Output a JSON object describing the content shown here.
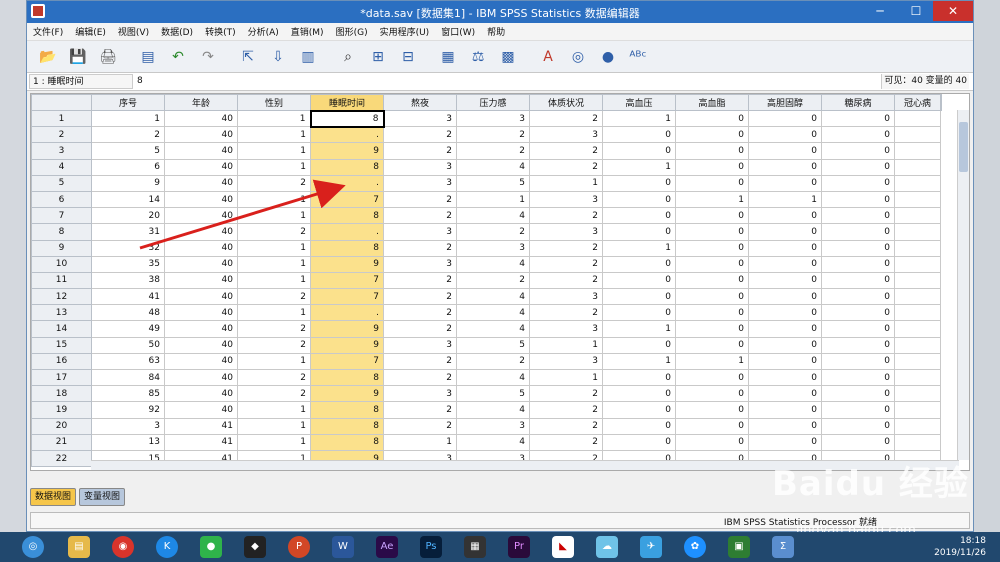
{
  "window": {
    "title": "*data.sav [数据集1] - IBM SPSS Statistics 数据编辑器",
    "min": "─",
    "max": "☐",
    "close": "✕"
  },
  "menu": [
    "文件(F)",
    "编辑(E)",
    "视图(V)",
    "数据(D)",
    "转换(T)",
    "分析(A)",
    "直销(M)",
    "图形(G)",
    "实用程序(U)",
    "窗口(W)",
    "帮助"
  ],
  "toolbar": [
    "open-icon",
    "save-icon",
    "print-icon",
    "recall-dialog-icon",
    "undo-icon",
    "redo-icon",
    "goto-case-icon",
    "goto-variable-icon",
    "variables-icon",
    "find-icon",
    "insert-cases-icon",
    "insert-variable-icon",
    "split-file-icon",
    "weight-cases-icon",
    "select-cases-icon",
    "value-labels-icon",
    "use-sets-icon",
    "show-all-icon",
    "spell-icon"
  ],
  "editline": {
    "cell_ref": "1 : 睡眠时间",
    "cell_value": "8",
    "visible": "可见：40 变量的 40"
  },
  "columns": [
    "序号",
    "年龄",
    "性别",
    "睡眠时间",
    "熬夜",
    "压力感",
    "体质状况",
    "高血压",
    "高血脂",
    "高胆固醇",
    "糖尿病",
    "冠心病"
  ],
  "rows": [
    [
      "1",
      "1",
      "40",
      "1",
      "8",
      "3",
      "3",
      "2",
      "1",
      "0",
      "0",
      "0",
      ""
    ],
    [
      "2",
      "2",
      "40",
      "1",
      ".",
      "2",
      "2",
      "3",
      "0",
      "0",
      "0",
      "0",
      ""
    ],
    [
      "3",
      "5",
      "40",
      "1",
      "9",
      "2",
      "2",
      "2",
      "0",
      "0",
      "0",
      "0",
      ""
    ],
    [
      "4",
      "6",
      "40",
      "1",
      "8",
      "3",
      "4",
      "2",
      "1",
      "0",
      "0",
      "0",
      ""
    ],
    [
      "5",
      "9",
      "40",
      "2",
      ".",
      "3",
      "5",
      "1",
      "0",
      "0",
      "0",
      "0",
      ""
    ],
    [
      "6",
      "14",
      "40",
      "1",
      "7",
      "2",
      "1",
      "3",
      "0",
      "1",
      "1",
      "0",
      ""
    ],
    [
      "7",
      "20",
      "40",
      "1",
      "8",
      "2",
      "4",
      "2",
      "0",
      "0",
      "0",
      "0",
      ""
    ],
    [
      "8",
      "31",
      "40",
      "2",
      ".",
      "3",
      "2",
      "3",
      "0",
      "0",
      "0",
      "0",
      ""
    ],
    [
      "9",
      "32",
      "40",
      "1",
      "8",
      "2",
      "3",
      "2",
      "1",
      "0",
      "0",
      "0",
      ""
    ],
    [
      "10",
      "35",
      "40",
      "1",
      "9",
      "3",
      "4",
      "2",
      "0",
      "0",
      "0",
      "0",
      ""
    ],
    [
      "11",
      "38",
      "40",
      "1",
      "7",
      "2",
      "2",
      "2",
      "0",
      "0",
      "0",
      "0",
      ""
    ],
    [
      "12",
      "41",
      "40",
      "2",
      "7",
      "2",
      "4",
      "3",
      "0",
      "0",
      "0",
      "0",
      ""
    ],
    [
      "13",
      "48",
      "40",
      "1",
      ".",
      "2",
      "4",
      "2",
      "0",
      "0",
      "0",
      "0",
      ""
    ],
    [
      "14",
      "49",
      "40",
      "2",
      "9",
      "2",
      "4",
      "3",
      "1",
      "0",
      "0",
      "0",
      ""
    ],
    [
      "15",
      "50",
      "40",
      "2",
      "9",
      "3",
      "5",
      "1",
      "0",
      "0",
      "0",
      "0",
      ""
    ],
    [
      "16",
      "63",
      "40",
      "1",
      "7",
      "2",
      "2",
      "3",
      "1",
      "1",
      "0",
      "0",
      ""
    ],
    [
      "17",
      "84",
      "40",
      "2",
      "8",
      "2",
      "4",
      "1",
      "0",
      "0",
      "0",
      "0",
      ""
    ],
    [
      "18",
      "85",
      "40",
      "2",
      "9",
      "3",
      "5",
      "2",
      "0",
      "0",
      "0",
      "0",
      ""
    ],
    [
      "19",
      "92",
      "40",
      "1",
      "8",
      "2",
      "4",
      "2",
      "0",
      "0",
      "0",
      "0",
      ""
    ],
    [
      "20",
      "3",
      "41",
      "1",
      "8",
      "2",
      "3",
      "2",
      "0",
      "0",
      "0",
      "0",
      ""
    ],
    [
      "21",
      "13",
      "41",
      "1",
      "8",
      "1",
      "4",
      "2",
      "0",
      "0",
      "0",
      "0",
      ""
    ],
    [
      "22",
      "15",
      "41",
      "1",
      "9",
      "3",
      "3",
      "2",
      "0",
      "0",
      "0",
      "0",
      ""
    ]
  ],
  "tabs": {
    "data_view": "数据视图",
    "variable_view": "变量视图"
  },
  "status": "IBM SPSS Statistics Processor 就绪",
  "clock": {
    "time": "18:18",
    "date": "2019/11/26"
  },
  "watermark": {
    "logo": "Baidu 经验",
    "url": "jingyan.baidu.com"
  },
  "colors": {
    "selected_column": "#fbe18c",
    "active_tab": "#f6c64a",
    "titlebar": "#2b6fc1",
    "arrow": "#d9201c"
  }
}
